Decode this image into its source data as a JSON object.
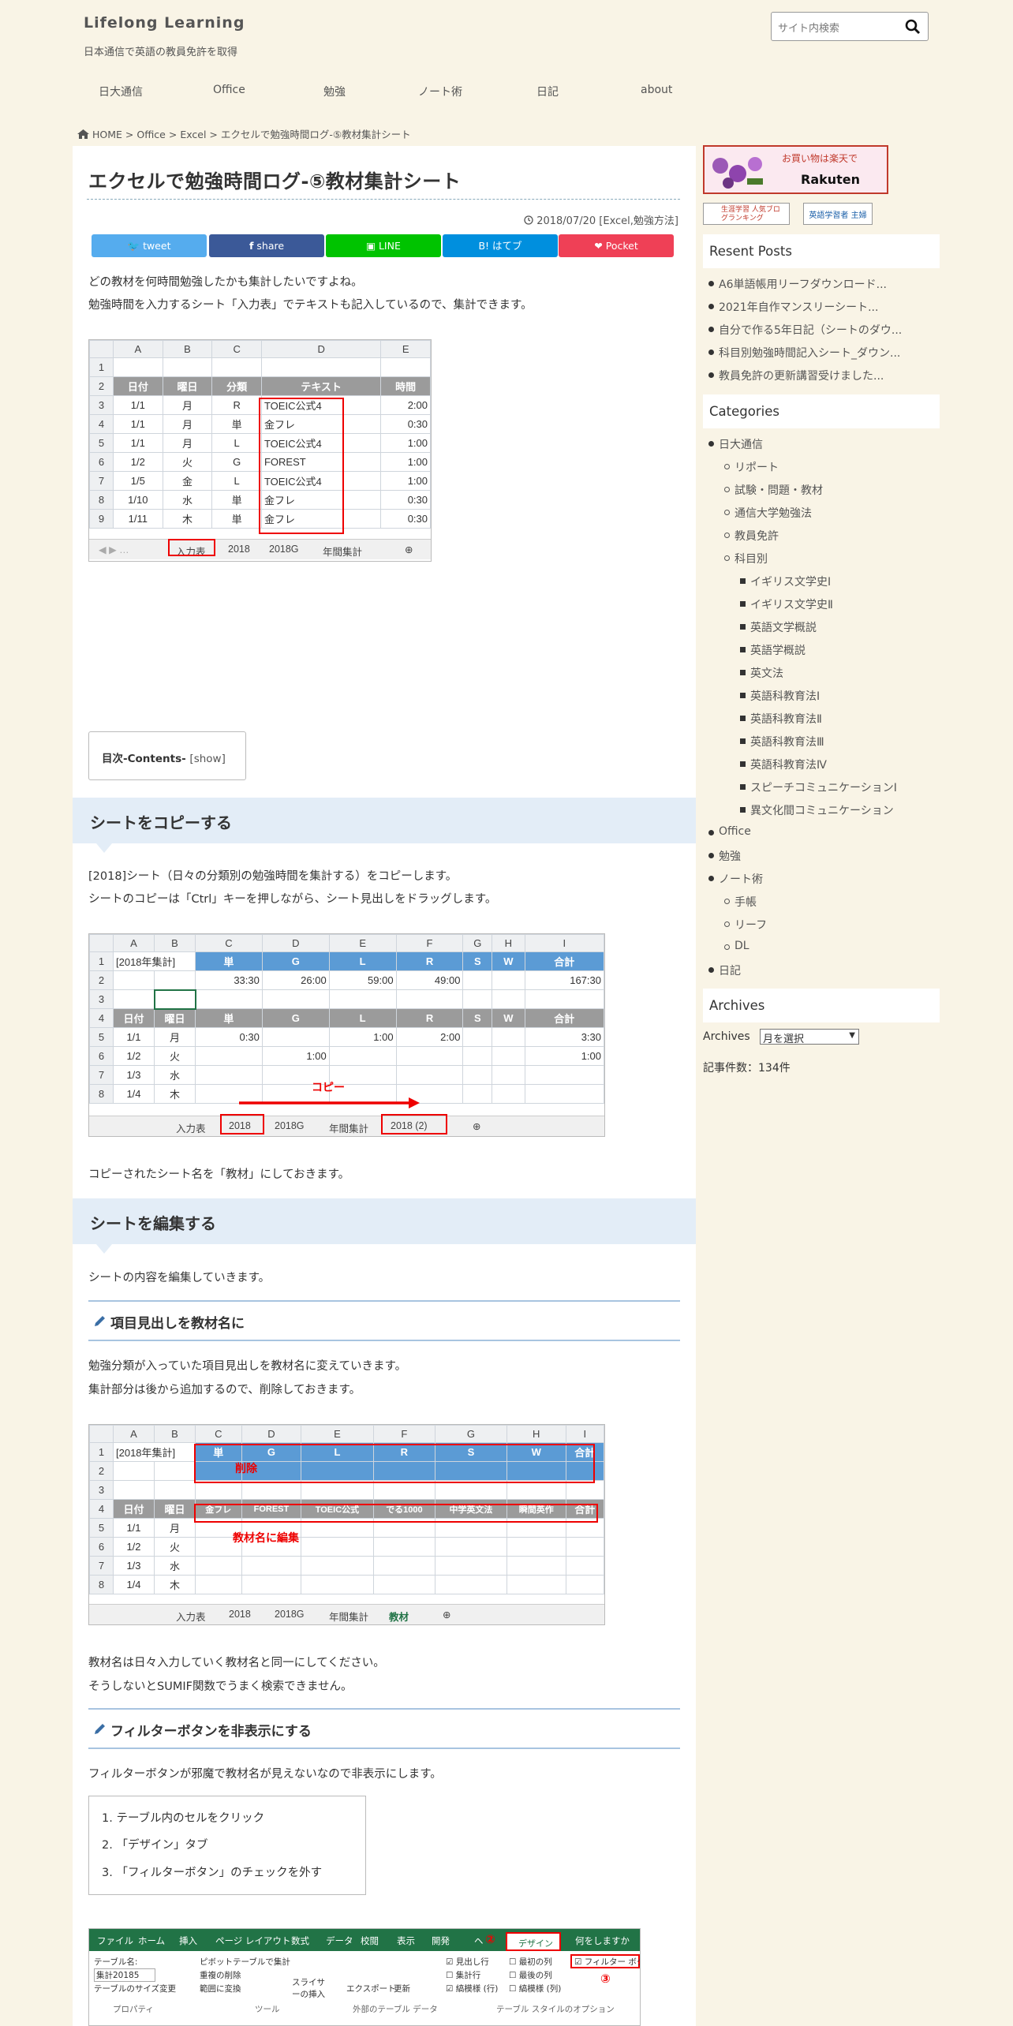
{
  "site": {
    "title": "Lifelong Learning",
    "description": "日本通信で英語の教員免許を取得",
    "search_placeholder": "サイト内検索"
  },
  "nav": [
    "日大通信",
    "Office",
    "勉強",
    "ノート術",
    "日記",
    "about"
  ],
  "breadcrumb": {
    "home": "HOME",
    "items": [
      "Office",
      "Excel",
      "エクセルで勉強時間ログ-⑤教材集計シート"
    ],
    "sep": ">"
  },
  "post": {
    "title": "エクセルで勉強時間ログ-⑤教材集計シート",
    "date": "2018/07/20",
    "categories": "[Excel,勉強方法]",
    "share": [
      {
        "label": "tweet",
        "color": "#55acee"
      },
      {
        "label": "share",
        "color": "#3b5998"
      },
      {
        "label": "LINE",
        "color": "#00c300"
      },
      {
        "label": "B! はてブ",
        "color": "#008fde"
      },
      {
        "label": "Pocket",
        "color": "#ef4056"
      }
    ],
    "intro": [
      "どの教材を何時間勉強したかも集計したいですよね。",
      "勉強時間を入力するシート「入力表」でテキストも記入しているので、集計できます。"
    ],
    "toc": {
      "label": "目次-Contents-",
      "toggle": "[show]"
    },
    "h2_copy": "シートをコピーする",
    "copy_text": [
      "[2018]シート（日々の分類別の勉強時間を集計する）をコピーします。",
      "シートのコピーは「Ctrl」キーを押しながら、シート見出しをドラッグします。"
    ],
    "copy_after": "コピーされたシート名を「教材」にしておきます。",
    "h2_edit": "シートを編集する",
    "edit_text": "シートの内容を編集していきます。",
    "h3_rename": "項目見出しを教材名に",
    "rename_text": [
      "勉強分類が入っていた項目見出しを教材名に変えていきます。",
      "集計部分は後から追加するので、削除しておきます。"
    ],
    "rename_after": [
      "教材名は日々入力していく教材名と同一にしてください。",
      "そうしないとSUMIF関数でうまく検索できません。"
    ],
    "h3_filter": "フィルターボタンを非表示にする",
    "filter_text": "フィルターボタンが邪魔で教材名が見えないなので非表示にします。",
    "steps": [
      "1. テーブル内のセルをクリック",
      "2. 「デザイン」タブ",
      "3. 「フィルターボタン」のチェックを外す"
    ]
  },
  "shot1": {
    "cols": [
      "A",
      "B",
      "C",
      "D",
      "E"
    ],
    "rows": [
      "1",
      "2",
      "3",
      "4",
      "5",
      "6",
      "7",
      "8",
      "9"
    ],
    "headers": [
      "日付",
      "曜日",
      "分類",
      "テキスト",
      "時間"
    ],
    "data": [
      [
        "1/1",
        "月",
        "R",
        "TOEIC公式4",
        "2:00"
      ],
      [
        "1/1",
        "月",
        "単",
        "金フレ",
        "0:30"
      ],
      [
        "1/1",
        "月",
        "L",
        "TOEIC公式4",
        "1:00"
      ],
      [
        "1/2",
        "火",
        "G",
        "FOREST",
        "1:00"
      ],
      [
        "1/5",
        "金",
        "L",
        "TOEIC公式4",
        "1:00"
      ],
      [
        "1/10",
        "水",
        "単",
        "金フレ",
        "0:30"
      ],
      [
        "1/11",
        "木",
        "単",
        "金フレ",
        "0:30"
      ]
    ],
    "tabs": [
      "入力表",
      "2018",
      "2018G",
      "年間集計"
    ]
  },
  "shot2": {
    "cols": [
      "A",
      "B",
      "C",
      "D",
      "E",
      "F",
      "G",
      "H",
      "I"
    ],
    "a1": "[2018年集計]",
    "sumhdr": [
      "単",
      "G",
      "L",
      "R",
      "S",
      "W",
      "合計"
    ],
    "sumvals": [
      "33:30",
      "26:00",
      "59:00",
      "49:00",
      "",
      "",
      "167:30"
    ],
    "hdr": [
      "日付",
      "曜日",
      "単",
      "G",
      "L",
      "R",
      "S",
      "W",
      "合計"
    ],
    "data": [
      [
        "1/1",
        "月",
        "0:30",
        "",
        "1:00",
        "2:00",
        "",
        "",
        "3:30"
      ],
      [
        "1/2",
        "火",
        "",
        "1:00",
        "",
        "",
        "",
        "",
        "1:00"
      ],
      [
        "1/3",
        "水",
        "",
        "",
        "",
        "",
        "",
        "",
        ""
      ],
      [
        "1/4",
        "木",
        "",
        "",
        "",
        "",
        "",
        "",
        ""
      ]
    ],
    "copy_label": "コピー",
    "tabs": [
      "入力表",
      "2018",
      "2018G",
      "年間集計",
      "2018 (2)"
    ]
  },
  "shot3": {
    "a1": "[2018年集計]",
    "hdr": [
      "日付",
      "曜日",
      "金フレ",
      "FOREST",
      "TOEIC公式",
      "でる1000",
      "中学英文法",
      "瞬間英作",
      "合計"
    ],
    "delete_label": "削除",
    "edit_label": "教材名に編集",
    "data": [
      [
        "1/1",
        "月"
      ],
      [
        "1/2",
        "火"
      ],
      [
        "1/3",
        "水"
      ],
      [
        "1/4",
        "木"
      ]
    ],
    "tabs": [
      "入力表",
      "2018",
      "2018G",
      "年間集計",
      "教材"
    ]
  },
  "ribbon": {
    "tabs": [
      "ファイル",
      "ホーム",
      "挿入",
      "ページ レイアウト",
      "数式",
      "データ",
      "校閲",
      "表示",
      "開発",
      "ヘ",
      "デザイン",
      "何をしますか"
    ],
    "table_name_label": "テーブル名:",
    "table_name": "集計20185",
    "resize": "テーブルのサイズ変更",
    "g_tools": [
      "ピボットテーブルで集計",
      "重複の削除",
      "範囲に変換"
    ],
    "slicer": "スライサーの挿入",
    "export": "エクスポート",
    "refresh": "更新",
    "opts": [
      "見出し行",
      "集計行",
      "縞模様 (行)",
      "最初の列",
      "最後の列",
      "縞模様 (列)",
      "フィルター ボタン"
    ],
    "groups": [
      "プロパティ",
      "ツール",
      "外部のテーブル データ",
      "テーブル スタイルのオプション"
    ],
    "mark2": "②",
    "mark3": "③"
  },
  "sidebar": {
    "banner_text": "お買い物は楽天で",
    "banner_brand": "Rakuten",
    "badge1": "生涯学習 人気ブログランキング",
    "badge2": "英語学習者 主婦",
    "recent_title": "Resent Posts",
    "recent": [
      "A6単語帳用リーフダウンロード...",
      "2021年自作マンスリーシート...",
      "自分で作る5年日記（シートのダウ...",
      "科目別勉強時間記入シート_ダウン...",
      "教員免許の更新講習受けました..."
    ],
    "cat_title": "Categories",
    "categories": [
      {
        "label": "日大通信",
        "level": 0
      },
      {
        "label": "リポート",
        "level": 1
      },
      {
        "label": "試験・問題・教材",
        "level": 1
      },
      {
        "label": "通信大学勉強法",
        "level": 1
      },
      {
        "label": "教員免許",
        "level": 1
      },
      {
        "label": "科目別",
        "level": 1
      },
      {
        "label": "イギリス文学史Ⅰ",
        "level": 2
      },
      {
        "label": "イギリス文学史Ⅱ",
        "level": 2
      },
      {
        "label": "英語文学概説",
        "level": 2
      },
      {
        "label": "英語学概説",
        "level": 2
      },
      {
        "label": "英文法",
        "level": 2
      },
      {
        "label": "英語科教育法Ⅰ",
        "level": 2
      },
      {
        "label": "英語科教育法Ⅱ",
        "level": 2
      },
      {
        "label": "英語科教育法Ⅲ",
        "level": 2
      },
      {
        "label": "英語科教育法Ⅳ",
        "level": 2
      },
      {
        "label": "スピーチコミュニケーションⅠ",
        "level": 2
      },
      {
        "label": "異文化間コミュニケーション",
        "level": 2
      },
      {
        "label": "Office",
        "level": 0
      },
      {
        "label": "勉強",
        "level": 0
      },
      {
        "label": "ノート術",
        "level": 0
      },
      {
        "label": "手帳",
        "level": 1
      },
      {
        "label": "リーフ",
        "level": 1
      },
      {
        "label": "DL",
        "level": 1
      },
      {
        "label": "日記",
        "level": 0
      }
    ],
    "arch_title": "Archives",
    "arch_label": "Archives",
    "arch_select": "月を選択",
    "count": "記事件数：134件"
  }
}
